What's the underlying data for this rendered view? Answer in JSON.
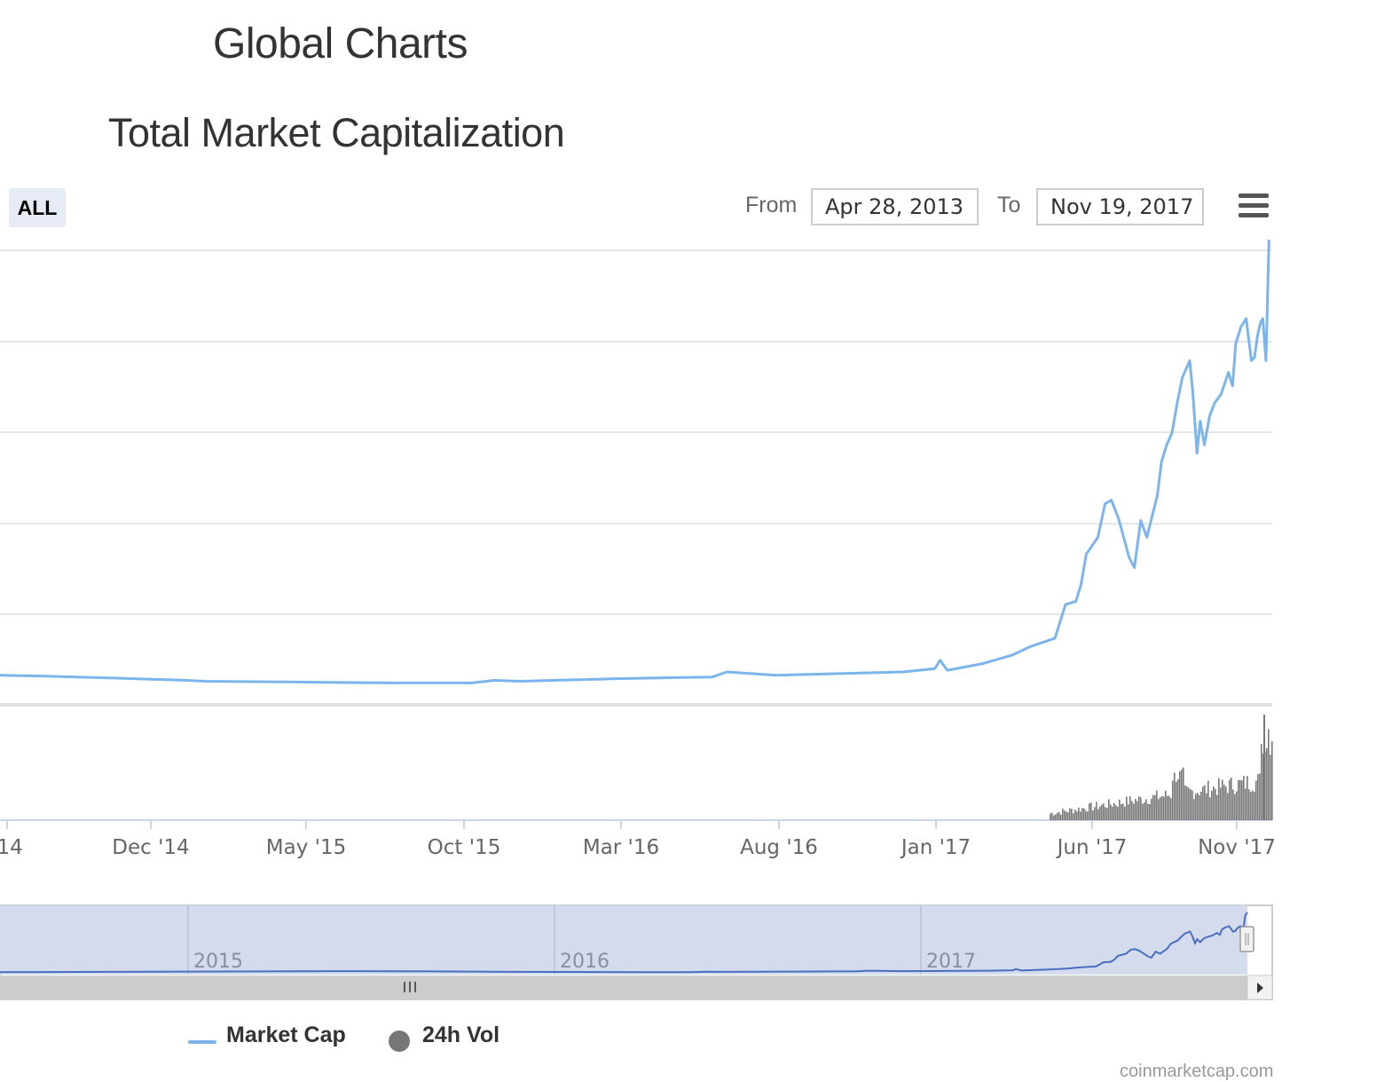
{
  "header": {
    "page_title": "Global Charts",
    "chart_title": "Total Market Capitalization"
  },
  "controls": {
    "range_button": "ALL",
    "from_label": "From",
    "from_value": "Apr 28, 2013",
    "to_label": "To",
    "to_value": "Nov 19, 2017",
    "menu_icon": "hamburger-menu-icon"
  },
  "legend": {
    "market_cap": "Market Cap",
    "volume": "24h Vol"
  },
  "credit": "coinmarketcap.com",
  "colors": {
    "market_cap_line": "#7cb5ec",
    "volume_bars": "#777777",
    "navigator_line": "#4a6fbf",
    "navigator_mask": "#d3dbed"
  },
  "chart_data": {
    "type": "line",
    "x_tick_labels": [
      "'14",
      "Dec '14",
      "May '15",
      "Oct '15",
      "Mar '16",
      "Aug '16",
      "Jan '17",
      "Jun '17",
      "Nov '17"
    ],
    "navigator_labels": [
      "2015",
      "2016",
      "2017"
    ],
    "grid": true,
    "y_axis_labels_visible": false,
    "legend_position": "bottom-left",
    "x_range": [
      "2014-07-20",
      "2017-11-19"
    ],
    "y_range": [
      0,
      250
    ],
    "series": [
      {
        "name": "Market Cap",
        "type": "line",
        "x": [
          "2014-07-20",
          "2014-09-01",
          "2014-11-01",
          "2015-01-15",
          "2015-02-01",
          "2015-05-01",
          "2015-08-01",
          "2015-10-15",
          "2015-11-05",
          "2015-12-01",
          "2016-03-01",
          "2016-06-01",
          "2016-06-15",
          "2016-08-01",
          "2016-12-01",
          "2016-12-31",
          "2017-01-05",
          "2017-01-12",
          "2017-02-15",
          "2017-03-15",
          "2017-04-01",
          "2017-04-25",
          "2017-05-05",
          "2017-05-15",
          "2017-05-20",
          "2017-05-25",
          "2017-06-05",
          "2017-06-12",
          "2017-06-18",
          "2017-06-25",
          "2017-07-05",
          "2017-07-10",
          "2017-07-16",
          "2017-07-22",
          "2017-08-01",
          "2017-08-05",
          "2017-08-10",
          "2017-08-15",
          "2017-08-20",
          "2017-08-25",
          "2017-09-01",
          "2017-09-04",
          "2017-09-08",
          "2017-09-11",
          "2017-09-15",
          "2017-09-20",
          "2017-09-25",
          "2017-10-01",
          "2017-10-08",
          "2017-10-12",
          "2017-10-15",
          "2017-10-20",
          "2017-10-25",
          "2017-10-30",
          "2017-11-02",
          "2017-11-05",
          "2017-11-08",
          "2017-11-10",
          "2017-11-13",
          "2017-11-16",
          "2017-11-19"
        ],
        "values": [
          8,
          7.5,
          6.5,
          5,
          4.5,
          4,
          3.5,
          3.5,
          5,
          4.5,
          6,
          7,
          10,
          8,
          10,
          12,
          17,
          11,
          15,
          20,
          25,
          30,
          50,
          52,
          62,
          80,
          90,
          110,
          112,
          101,
          78,
          72,
          100,
          90,
          115,
          135,
          145,
          152,
          170,
          185,
          195,
          176,
          140,
          159,
          145,
          162,
          170,
          175,
          188,
          180,
          205,
          215,
          220,
          195,
          197,
          210,
          218,
          220,
          195,
          270,
          285
        ]
      },
      {
        "name": "24h Vol",
        "type": "column",
        "values_described": "near zero until Apr '17, rising to ~20-30% of panel height mid-2017, spikes near Nov '17 (max ~13B)"
      }
    ]
  }
}
